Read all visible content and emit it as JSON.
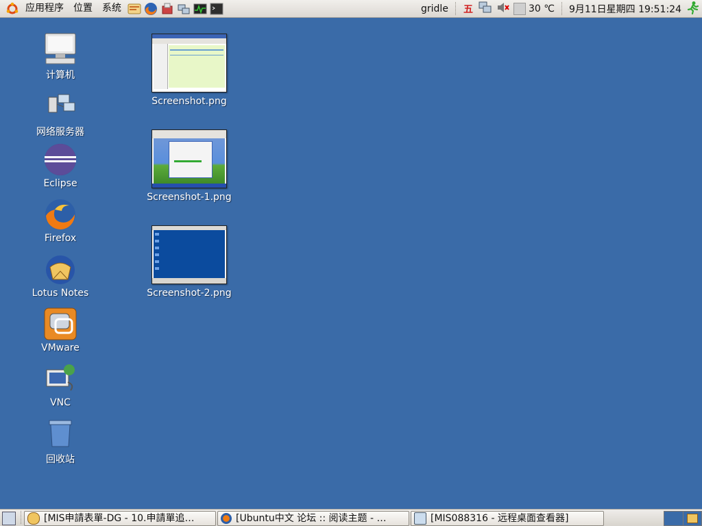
{
  "top_panel": {
    "menus": [
      "应用程序",
      "位置",
      "系统"
    ],
    "launchers": [
      "notes-launcher-icon",
      "firefox-launcher-icon",
      "package-launcher-icon",
      "network-launcher-icon",
      "monitor-launcher-icon",
      "terminal-launcher-icon"
    ],
    "tray": {
      "hostname": "gridle",
      "input_method": "五",
      "temperature": "30 ℃",
      "datetime": "9月11日星期四 19:51:24"
    }
  },
  "desktop": {
    "icons": [
      {
        "label": "计算机",
        "icon": "computer-icon"
      },
      {
        "label": "网络服务器",
        "icon": "network-servers-icon"
      },
      {
        "label": "Eclipse",
        "icon": "eclipse-icon"
      },
      {
        "label": "Firefox",
        "icon": "firefox-icon"
      },
      {
        "label": "Lotus Notes",
        "icon": "lotus-notes-icon"
      },
      {
        "label": "VMware",
        "icon": "vmware-icon"
      },
      {
        "label": "VNC",
        "icon": "vnc-icon"
      },
      {
        "label": "回收站",
        "icon": "trash-icon"
      }
    ],
    "files": [
      {
        "label": "Screenshot.png"
      },
      {
        "label": "Screenshot-1.png"
      },
      {
        "label": "Screenshot-2.png"
      }
    ]
  },
  "taskbar": {
    "tasks": [
      {
        "label": "[MIS申請表單-DG - 10.申請單追…"
      },
      {
        "label": "[Ubuntu中文 论坛 :: 阅读主题 - …"
      },
      {
        "label": "[MIS088316 - 远程桌面查看器]"
      }
    ]
  },
  "colors": {
    "desktop": "#3a6ba8",
    "panel": "#e6e3de"
  }
}
